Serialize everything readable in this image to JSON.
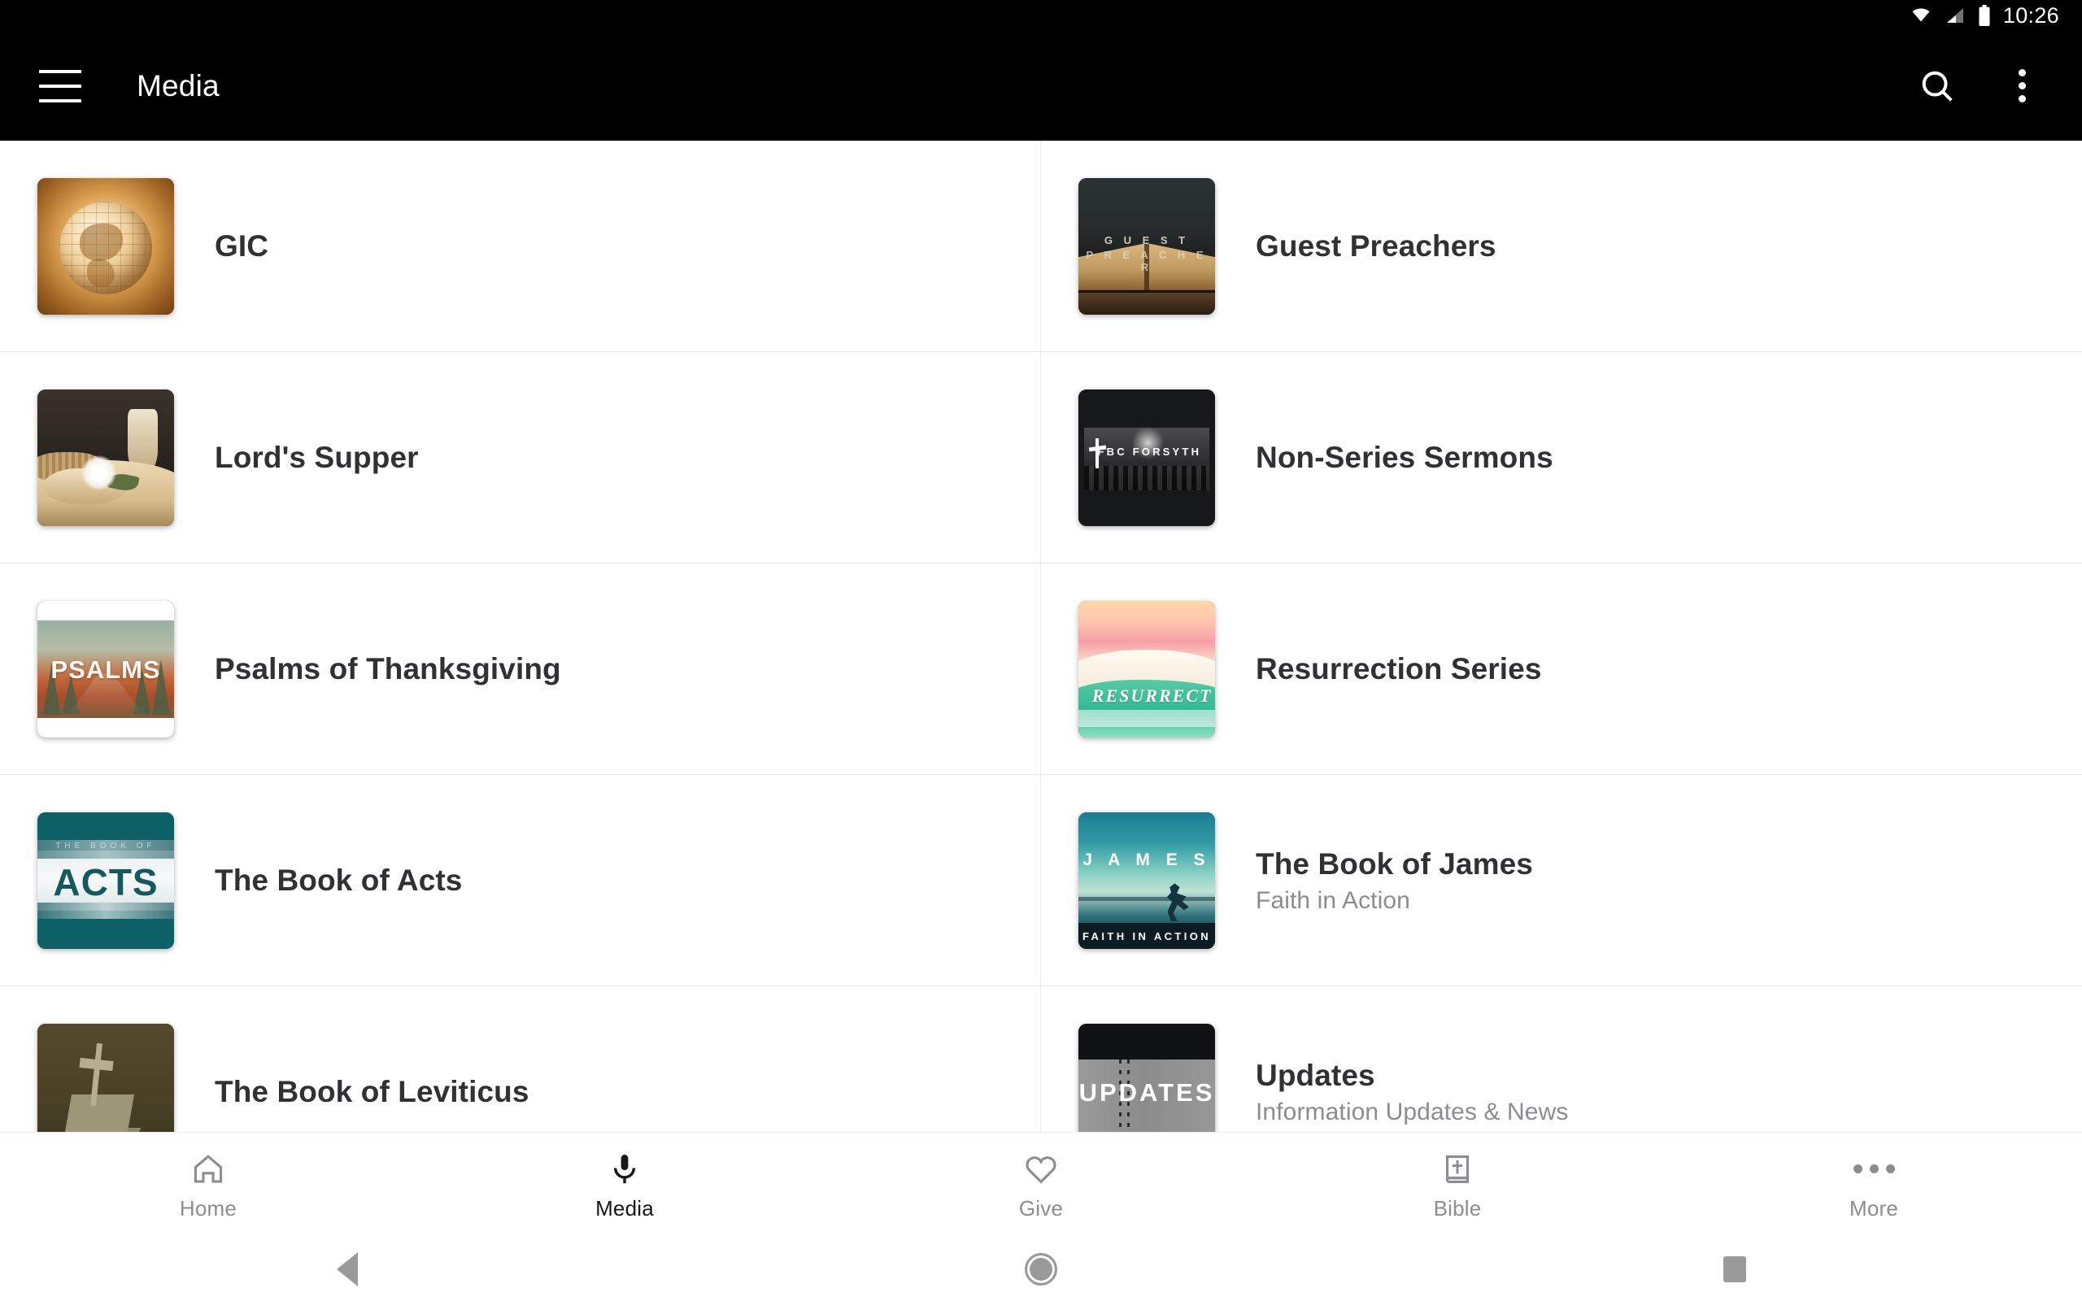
{
  "statusbar": {
    "time": "10:26",
    "icons": [
      "wifi-icon",
      "cellular-signal-icon",
      "battery-icon"
    ]
  },
  "appbar": {
    "title": "Media",
    "menu_icon": "hamburger-menu-icon",
    "search_icon": "search-icon",
    "overflow_icon": "overflow-menu-icon"
  },
  "list": {
    "rows": [
      {
        "left": {
          "title": "GIC",
          "subtitle": "",
          "art": "a-gic",
          "art_label": ""
        },
        "right": {
          "title": "Guest Preachers",
          "subtitle": "",
          "art": "a-guest",
          "art_label_1": "G U E S T",
          "art_label_2": "P R E A C H E R"
        }
      },
      {
        "left": {
          "title": "Lord's Supper",
          "subtitle": "",
          "art": "a-supper"
        },
        "right": {
          "title": "Non-Series Sermons",
          "subtitle": "",
          "art": "a-fbc",
          "art_label": "FBC FORSYTH"
        }
      },
      {
        "left": {
          "title": "Psalms of Thanksgiving",
          "subtitle": "",
          "art": "a-psalms",
          "art_label": "PSALMS"
        },
        "right": {
          "title": "Resurrection Series",
          "subtitle": "",
          "art": "a-res",
          "art_label": "RESURRECT"
        }
      },
      {
        "left": {
          "title": "The Book of Acts",
          "subtitle": "",
          "art": "a-acts",
          "art_label_small": "THE BOOK OF",
          "art_label": "ACTS"
        },
        "right": {
          "title": "The Book of James",
          "subtitle": "Faith in Action",
          "art": "a-james",
          "art_label": "J A M E S",
          "art_label_2": "FAITH IN ACTION"
        }
      },
      {
        "left": {
          "title": "The Book of Leviticus",
          "subtitle": "",
          "art": "a-lev"
        },
        "right": {
          "title": "Updates",
          "subtitle": "Information Updates & News",
          "art": "a-upd",
          "art_label": "UPDATES"
        }
      }
    ]
  },
  "bottomnav": {
    "tabs": [
      {
        "label": "Home",
        "icon": "home-icon",
        "active": false
      },
      {
        "label": "Media",
        "icon": "microphone-icon",
        "active": true
      },
      {
        "label": "Give",
        "icon": "heart-icon",
        "active": false
      },
      {
        "label": "Bible",
        "icon": "bible-book-icon",
        "active": false
      },
      {
        "label": "More",
        "icon": "more-dots-icon",
        "active": false
      }
    ]
  },
  "sysnav": {
    "back": "back-triangle-icon",
    "home": "home-circle-icon",
    "recents": "recents-square-icon"
  },
  "colors": {
    "appbar_bg": "#000000",
    "page_bg": "#ffffff",
    "title_text": "#2f3133",
    "subtitle_text": "#8a8d90",
    "nav_inactive": "#8b8e90",
    "nav_active": "#16181a",
    "divider": "#e8e8e8"
  }
}
